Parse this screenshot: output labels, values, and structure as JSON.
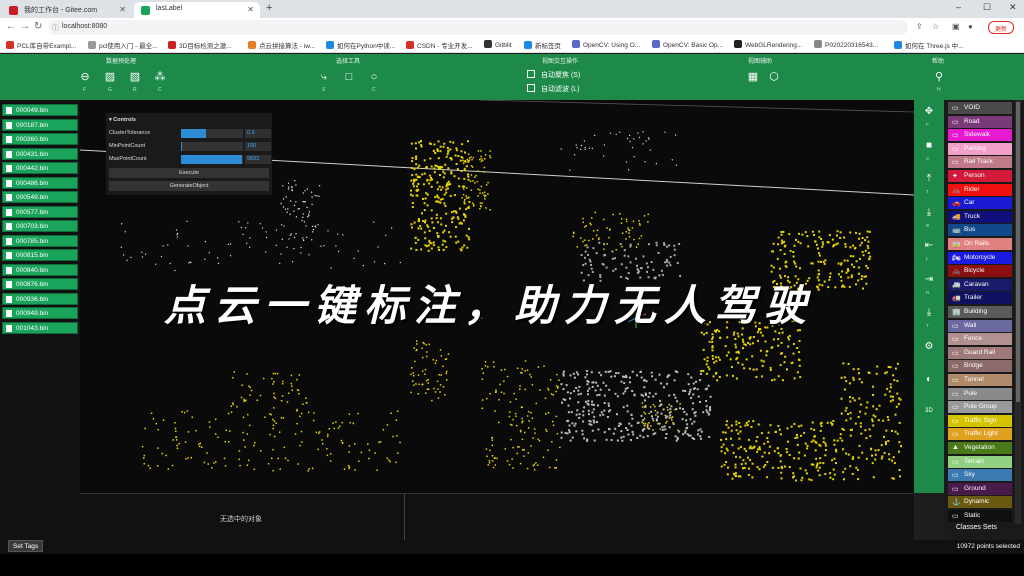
{
  "browser": {
    "tabs": [
      {
        "title": "我的工作台 - Gitee.com",
        "color": "#c71d23"
      },
      {
        "title": "lasLabel",
        "color": "#1aa35a"
      }
    ],
    "new_tab": "+",
    "url": "localhost:8080",
    "update_label": "更新",
    "window_controls": [
      "–",
      "☐",
      "✕"
    ],
    "bookmarks": [
      {
        "label": "PCL库自带Exampl...",
        "color": "#d93025"
      },
      {
        "label": "pcl使用入门 - 最全...",
        "color": "#999999"
      },
      {
        "label": "3D目标检测之激...",
        "color": "#cc2222"
      },
      {
        "label": "点云拼接算法 - iw...",
        "color": "#e67e22"
      },
      {
        "label": "如何在Python中读...",
        "color": "#1e88e5"
      },
      {
        "label": "CSDN - 专业开发...",
        "color": "#d93025"
      },
      {
        "label": "Gitblit",
        "color": "#333333"
      },
      {
        "label": "新标签页",
        "color": "#1e88e5"
      },
      {
        "label": "OpenCV: Using O...",
        "color": "#5c6bc0"
      },
      {
        "label": "OpenCV: Basic Op...",
        "color": "#5c6bc0"
      },
      {
        "label": "WebGLRendering...",
        "color": "#222222"
      },
      {
        "label": "P020220316543...",
        "color": "#888888"
      },
      {
        "label": "如何在 Three.js 中...",
        "color": "#1e88e5"
      }
    ]
  },
  "menubar": {
    "groups": [
      "数据预处理",
      "选择工具",
      "视图交互操作",
      "视图辅助",
      "帮助"
    ],
    "preprocess_icons": [
      {
        "name": "filter-icon",
        "glyph": "⊖",
        "key": "F"
      },
      {
        "name": "grid-icon",
        "glyph": "▨",
        "key": "G"
      },
      {
        "name": "ground-icon",
        "glyph": "▧",
        "key": "R"
      },
      {
        "name": "cluster-icon",
        "glyph": "⁂",
        "key": "C"
      }
    ],
    "select_icons": [
      {
        "name": "pointer-icon",
        "glyph": "⤷",
        "key": "S"
      },
      {
        "name": "rect-select-icon",
        "glyph": "□",
        "key": ""
      },
      {
        "name": "circle-select-icon",
        "glyph": "○",
        "key": "C"
      }
    ],
    "auto_focus": "自动聚焦 (S)",
    "auto_filter": "自动滤波 (L)",
    "view_icons": [
      {
        "name": "grid-view-icon",
        "glyph": "▦"
      },
      {
        "name": "cube-icon",
        "glyph": "⬡"
      }
    ],
    "help_icon": {
      "name": "help-icon",
      "glyph": "⚲",
      "key": "H"
    }
  },
  "files": [
    "000049.bin",
    "000187.bin",
    "000360.bin",
    "000431.bin",
    "000442.bin",
    "000486.bin",
    "000549.bin",
    "000577.bin",
    "000703.bin",
    "000785.bin",
    "000815.bin",
    "000840.bin",
    "000876.bin",
    "000936.bin",
    "000949.bin",
    "001043.bin"
  ],
  "controls": {
    "header": "Controls",
    "rows": [
      {
        "label": "ClusterTolerance",
        "value": "0.5",
        "fraction": 0.4
      },
      {
        "label": "MinPointCount",
        "value": "100",
        "fraction": 0.01
      },
      {
        "label": "MaxPointCount",
        "value": "9833",
        "fraction": 0.98
      }
    ],
    "execute": "Execute",
    "generate": "GenerateObject"
  },
  "overlay": "点云一键标注，助力无人驾驶",
  "status": {
    "message": "无选中的对象"
  },
  "right_tools": [
    {
      "name": "move-icon",
      "glyph": "✥",
      "key": "F"
    },
    {
      "name": "camera-icon",
      "glyph": "■",
      "key": "C"
    },
    {
      "name": "top-view-icon",
      "glyph": "⤒",
      "key": "T"
    },
    {
      "name": "bottom-view-icon",
      "glyph": "⤓",
      "key": "B"
    },
    {
      "name": "left-view-icon",
      "glyph": "⇤",
      "key": "L"
    },
    {
      "name": "right-view-icon",
      "glyph": "⇥",
      "key": "R"
    },
    {
      "name": "front-view-icon",
      "glyph": "⤓",
      "key": "T"
    },
    {
      "name": "settings-icon",
      "glyph": "⚙",
      "key": ""
    },
    {
      "name": "contrast-icon",
      "glyph": "◐",
      "key": ""
    },
    {
      "name": "3d-icon",
      "glyph": "3D",
      "key": ""
    }
  ],
  "classes": [
    {
      "label": "VOID",
      "color": "#4a4a4a",
      "icon": "▭"
    },
    {
      "label": "Road",
      "color": "#7a3a7a",
      "icon": "▭"
    },
    {
      "label": "Sidewalk",
      "color": "#e51ad1",
      "icon": "▭"
    },
    {
      "label": "Parking",
      "color": "#f0a0c8",
      "icon": "▭"
    },
    {
      "label": "Rail Track",
      "color": "#c07a8a",
      "icon": "▭"
    },
    {
      "label": "Person",
      "color": "#d41a3a",
      "icon": "✦"
    },
    {
      "label": "Rider",
      "color": "#f01010",
      "icon": "🚲"
    },
    {
      "label": "Car",
      "color": "#1a1ad4",
      "icon": "🚗"
    },
    {
      "label": "Truck",
      "color": "#10107a",
      "icon": "🚚"
    },
    {
      "label": "Bus",
      "color": "#104a8a",
      "icon": "🚌"
    },
    {
      "label": "On Rails",
      "color": "#e08080",
      "icon": "🚋"
    },
    {
      "label": "Motorcycle",
      "color": "#1a1ae0",
      "icon": "🏍"
    },
    {
      "label": "Bicycle",
      "color": "#8a1010",
      "icon": "🚲"
    },
    {
      "label": "Caravan",
      "color": "#1a1a6a",
      "icon": "🚐"
    },
    {
      "label": "Trailer",
      "color": "#101060",
      "icon": "🚛"
    },
    {
      "label": "Building",
      "color": "#5a5a5a",
      "icon": "🏢"
    },
    {
      "label": "Wall",
      "color": "#6a6aa0",
      "icon": "▭"
    },
    {
      "label": "Fence",
      "color": "#b09090",
      "icon": "▭"
    },
    {
      "label": "Guard Rail",
      "color": "#a07a7a",
      "icon": "▭"
    },
    {
      "label": "Bridge",
      "color": "#8a6a6a",
      "icon": "▭"
    },
    {
      "label": "Tunnel",
      "color": "#b08a6a",
      "icon": "▭"
    },
    {
      "label": "Pole",
      "color": "#8a8a8a",
      "icon": "▭"
    },
    {
      "label": "Pole Group",
      "color": "#9a9a9a",
      "icon": "▭"
    },
    {
      "label": "Traffic Sign",
      "color": "#d4c400",
      "icon": "▭"
    },
    {
      "label": "Traffic Light",
      "color": "#e0a020",
      "icon": "▭"
    },
    {
      "label": "Vegetation",
      "color": "#4a7a1a",
      "icon": "▲"
    },
    {
      "label": "Terrain",
      "color": "#90d080",
      "icon": "▭"
    },
    {
      "label": "Sky",
      "color": "#3a7ab0",
      "icon": "▭"
    },
    {
      "label": "Ground",
      "color": "#4a1a4a",
      "icon": "▭"
    },
    {
      "label": "Dynamic",
      "color": "#6a5a10",
      "icon": "⚓"
    },
    {
      "label": "Static",
      "color": "#101010",
      "icon": "▭"
    }
  ],
  "class_sets": "Classes Sets",
  "set_tags": "Set Tags",
  "points_selected": "10972 points selected"
}
